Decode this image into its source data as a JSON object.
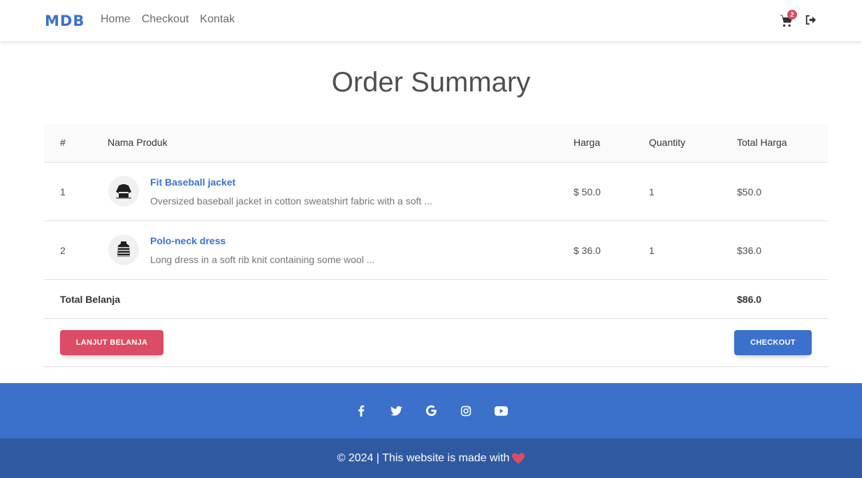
{
  "navbar": {
    "brand": "MDB",
    "links": [
      "Home",
      "Checkout",
      "Kontak"
    ],
    "cart_count": "2"
  },
  "page": {
    "title": "Order Summary"
  },
  "table": {
    "headers": [
      "#",
      "Nama Produk",
      "Harga",
      "Quantity",
      "Total Harga"
    ],
    "rows": [
      {
        "no": "1",
        "name": "Fit Baseball jacket",
        "desc": "Oversized baseball jacket in cotton sweatshirt fabric with a soft ...",
        "price": "$ 50.0",
        "qty": "1",
        "total": "$50.0"
      },
      {
        "no": "2",
        "name": "Polo-neck dress",
        "desc": "Long dress in a soft rib knit containing some wool ...",
        "price": "$ 36.0",
        "qty": "1",
        "total": "$36.0"
      }
    ],
    "total_label": "Total Belanja",
    "total_value": "$86.0"
  },
  "buttons": {
    "continue": "LANJUT BELANJA",
    "checkout": "CHECKOUT"
  },
  "footer": {
    "social_icons": [
      "facebook-icon",
      "twitter-icon",
      "google-icon",
      "instagram-icon",
      "youtube-icon"
    ],
    "copyright": "© 2024 | This website is made with"
  },
  "colors": {
    "primary": "#3b71ca",
    "danger": "#dc4c64",
    "footer_dark": "#2f5aa2"
  }
}
